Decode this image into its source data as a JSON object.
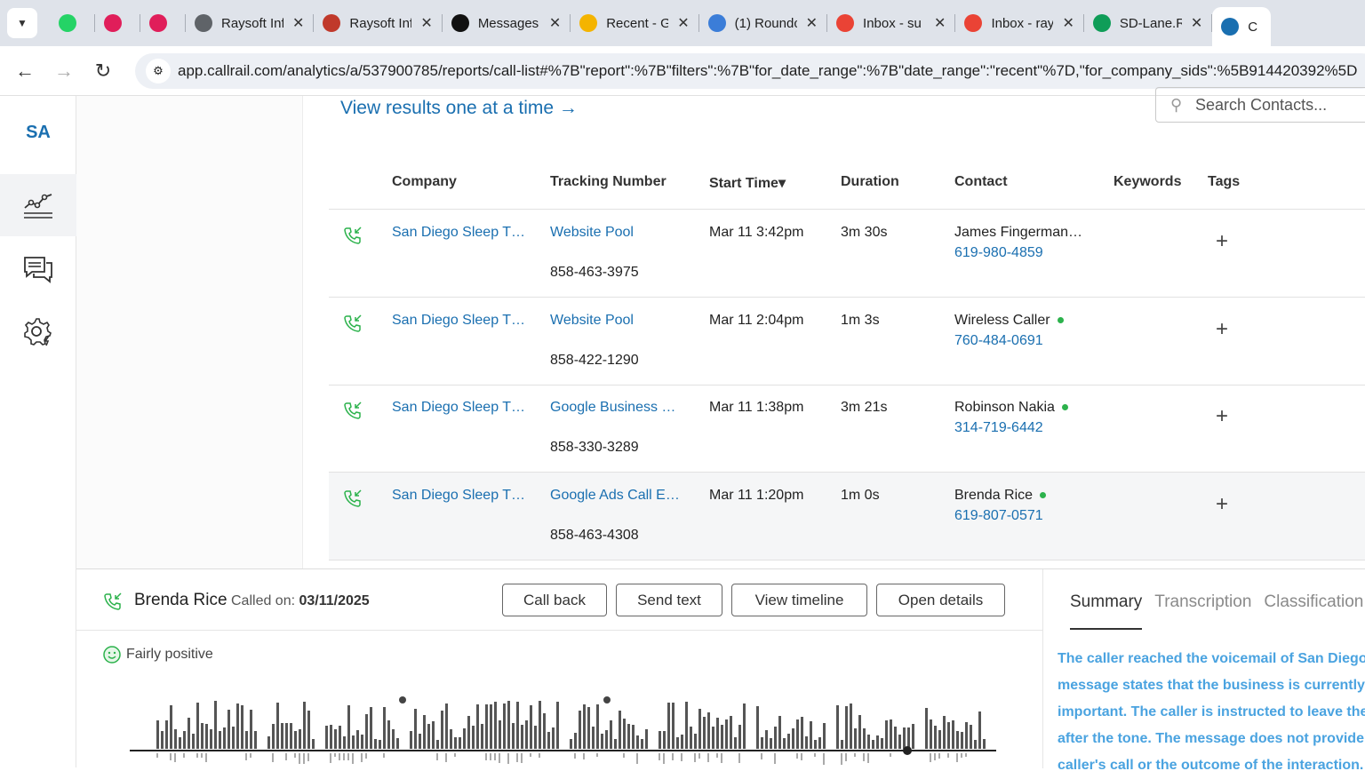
{
  "browser": {
    "tabs": [
      {
        "label": "",
        "icon": "whatsapp-icon",
        "color": "#25d366"
      },
      {
        "label": "",
        "icon": "slack-icon",
        "color": "#e01e5a"
      },
      {
        "label": "",
        "icon": "slack-icon",
        "color": "#e01e5a"
      },
      {
        "label": "Raysoft Inf",
        "icon": "globe-icon",
        "color": "#5f6368"
      },
      {
        "label": "Raysoft Inf",
        "icon": "raysoft-icon",
        "color": "#c0392b"
      },
      {
        "label": "Messages",
        "icon": "upwork-icon",
        "color": "#111"
      },
      {
        "label": "Recent - G",
        "icon": "drive-icon",
        "color": "#f4b400"
      },
      {
        "label": "(1) Roundc",
        "icon": "roundcube-icon",
        "color": "#3b7dd8"
      },
      {
        "label": "Inbox - su",
        "icon": "gmail-icon",
        "color": "#ea4335"
      },
      {
        "label": "Inbox - ray",
        "icon": "gmail-icon",
        "color": "#ea4335"
      },
      {
        "label": "SD-Lane.R",
        "icon": "sheets-icon",
        "color": "#0f9d58"
      },
      {
        "label": "C",
        "icon": "callrail-icon",
        "color": "#1a6fb0"
      }
    ],
    "url": "app.callrail.com/analytics/a/537900785/reports/call-list#%7B\"report\":%7B\"filters\":%7B\"for_date_range\":%7B\"date_range\":\"recent\"%7D,\"for_company_sids\":%5B914420392%5D"
  },
  "sidebar": {
    "initials": "SA",
    "items": [
      {
        "name": "analytics-icon"
      },
      {
        "name": "messages-icon"
      },
      {
        "name": "settings-icon"
      }
    ]
  },
  "main": {
    "view_link": "View results one at a time →",
    "search_placeholder": "Search Contacts...",
    "columns": {
      "company": "Company",
      "tracking": "Tracking Number",
      "start": "Start Time▾",
      "duration": "Duration",
      "contact": "Contact",
      "keywords": "Keywords",
      "tags": "Tags"
    },
    "rows": [
      {
        "company": "San Diego Sleep T…",
        "source": "Website Pool",
        "tracking": "858-463-3975",
        "start": "Mar 11 3:42pm",
        "duration": "3m 30s",
        "contact": "James Fingerman…",
        "phone": "619-980-4859",
        "online": false,
        "tag": "+"
      },
      {
        "company": "San Diego Sleep T…",
        "source": "Website Pool",
        "tracking": "858-422-1290",
        "start": "Mar 11 2:04pm",
        "duration": "1m 3s",
        "contact": "Wireless Caller",
        "phone": "760-484-0691",
        "online": true,
        "tag": "+"
      },
      {
        "company": "San Diego Sleep T…",
        "source": "Google Business …",
        "tracking": "858-330-3289",
        "start": "Mar 11 1:38pm",
        "duration": "3m 21s",
        "contact": "Robinson Nakia",
        "phone": "314-719-6442",
        "online": true,
        "tag": "+"
      },
      {
        "company": "San Diego Sleep T…",
        "source": "Google Ads Call E…",
        "tracking": "858-463-4308",
        "start": "Mar 11 1:20pm",
        "duration": "1m 0s",
        "contact": "Brenda Rice",
        "phone": "619-807-0571",
        "online": true,
        "tag": "+"
      }
    ]
  },
  "detail": {
    "name": "Brenda Rice",
    "called_label": "Called on:",
    "called_date": "03/11/2025",
    "buttons": {
      "call_back": "Call back",
      "send_text": "Send text",
      "view_timeline": "View timeline",
      "open_details": "Open details"
    },
    "sentiment": "Fairly positive",
    "tabs": {
      "summary": "Summary",
      "transcription": "Transcription",
      "classification": "Classification"
    },
    "summary_lines": [
      "The caller reached the voicemail of San Diego S",
      "message states that the business is currently a",
      "important. The caller is instructed to leave the",
      "after the tone. The message does not provide a",
      "caller's call or the outcome of the interaction."
    ]
  },
  "colors": {
    "accent": "#1a6fb0",
    "online_dot": "#2cb24c",
    "summary_text": "#4aa3e0"
  }
}
